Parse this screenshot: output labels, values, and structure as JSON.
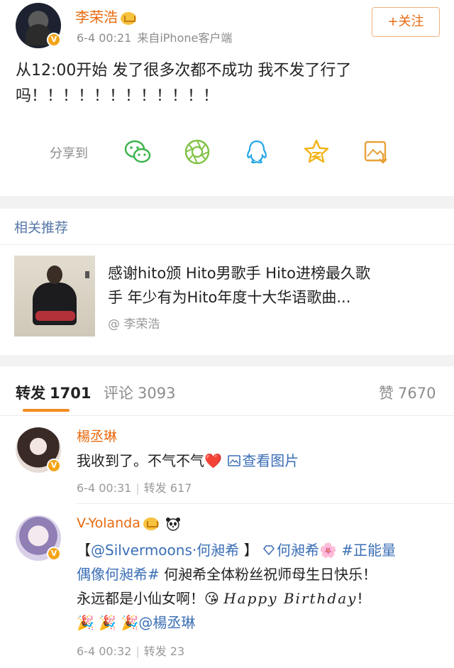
{
  "post": {
    "author": "李荣浩",
    "time": "6-4 00:21",
    "source": "来自iPhone客户端",
    "follow_label": "+关注",
    "text_line1": "从12:00开始 发了很多次都不成功 我不发了行了",
    "text_line2": "吗！！！！！！！！！！！！",
    "share_label": "分享到",
    "share_icons": [
      "wechat-icon",
      "moments-icon",
      "qq-icon",
      "qzone-icon",
      "save-image-icon"
    ],
    "badge": "V"
  },
  "related": {
    "heading": "相关推荐",
    "title_line1": "感谢hito颁 Hito男歌手 Hito进榜最久歌",
    "title_line2": "手  年少有为Hito年度十大华语歌曲...",
    "source": "@ 李荣浩"
  },
  "tabs": {
    "repost_label": "转发",
    "repost_count": "1701",
    "comment_label": "评论",
    "comment_count": "3093",
    "like_label": "赞",
    "like_count": "7670"
  },
  "comments": [
    {
      "name": "楊丞琳",
      "text": "我收到了。不气不气",
      "heart": "❤️",
      "view_image": "查看图片",
      "time": "6-4 00:31",
      "repost": "转发 617",
      "badge": "V"
    },
    {
      "name": "V-Yolanda",
      "line1_open": "【",
      "line1_mention": "@Silvermoons·何昶希",
      "line1_close": " 】",
      "line1_topic": "何昶希",
      "line1_flower": "🌸",
      "line1_hashtag": "#正能量",
      "line2_hashtag": "偶像何昶希#",
      "line2_text": "何昶希全体粉丝祝师母生日快乐！",
      "line3_text": "永远都是小仙女啊！",
      "line3_emoji": "😘",
      "line3_script": "Happy Birthday",
      "line3_bang": "!",
      "line4_party": "🎉 🎉 🎉",
      "line4_mention": "@楊丞琳",
      "time": "6-4 00:32",
      "repost": "转发 23",
      "badge": "V"
    }
  ],
  "colors": {
    "accent": "#e86a10",
    "link": "#3b6fb6",
    "tab_underline": "#f28a1e",
    "separator": "#f2f2f2"
  }
}
